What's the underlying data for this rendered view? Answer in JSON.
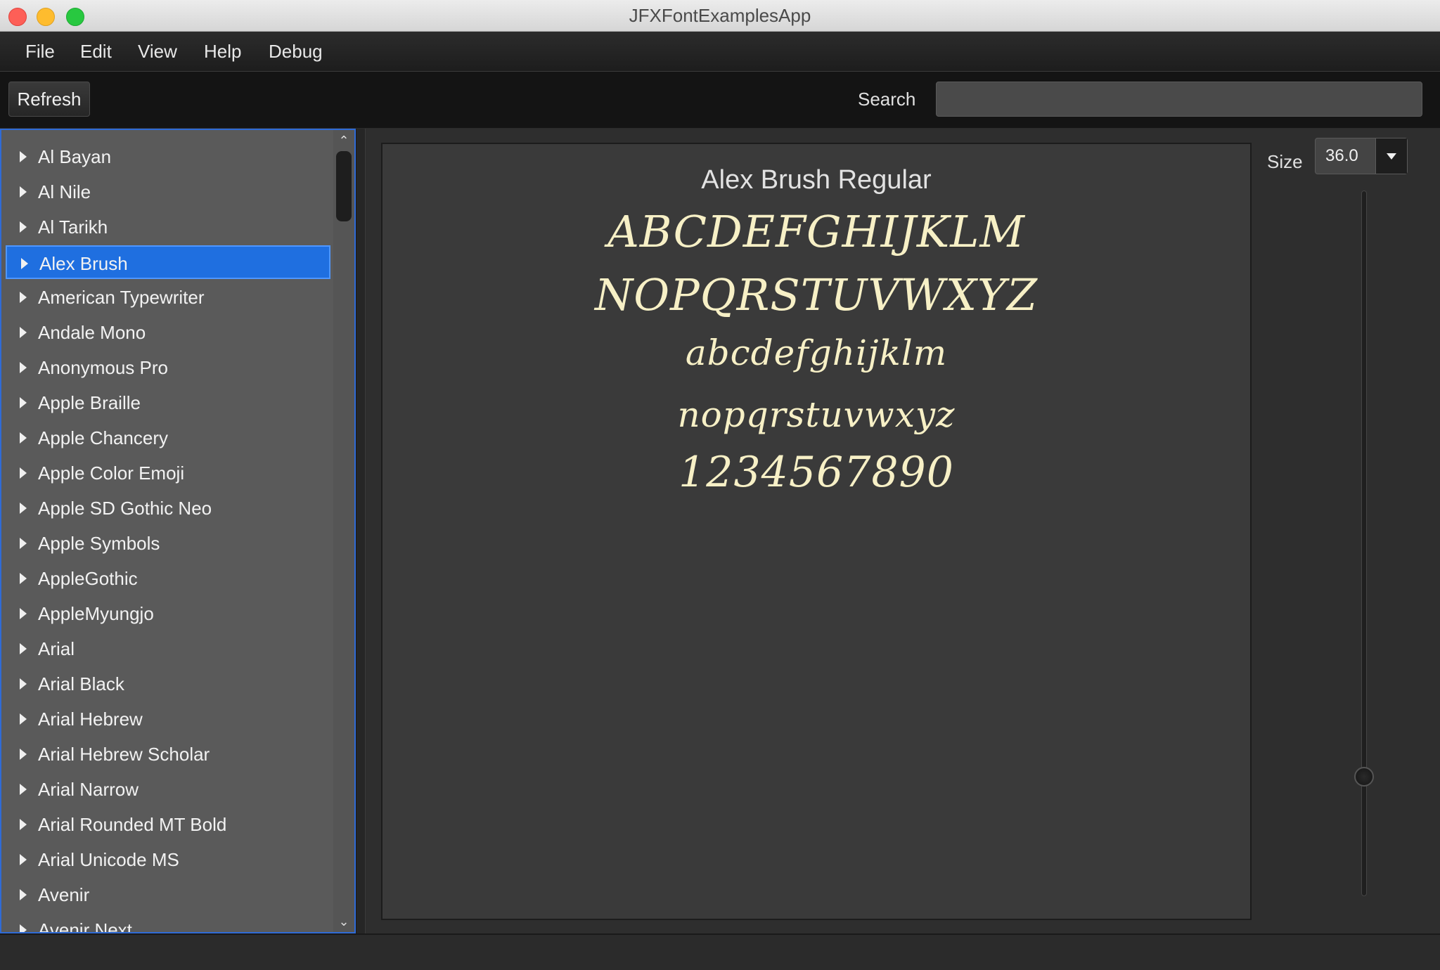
{
  "window": {
    "title": "JFXFontExamplesApp"
  },
  "menu": {
    "items": [
      "File",
      "Edit",
      "View",
      "Help",
      "Debug"
    ]
  },
  "toolbar": {
    "refresh_label": "Refresh",
    "search_label": "Search",
    "search_value": "",
    "search_placeholder": ""
  },
  "font_list": {
    "selected": "Alex Brush",
    "items": [
      "Al Bayan",
      "Al Nile",
      "Al Tarikh",
      "Alex Brush",
      "American Typewriter",
      "Andale Mono",
      "Anonymous Pro",
      "Apple Braille",
      "Apple Chancery",
      "Apple Color Emoji",
      "Apple SD Gothic Neo",
      "Apple Symbols",
      "AppleGothic",
      "AppleMyungjo",
      "Arial",
      "Arial Black",
      "Arial Hebrew",
      "Arial Hebrew Scholar",
      "Arial Narrow",
      "Arial Rounded MT Bold",
      "Arial Unicode MS",
      "Avenir",
      "Avenir Next"
    ]
  },
  "preview": {
    "font_name": "Alex Brush Regular",
    "lines": [
      "ABCDEFGHIJKLM",
      "NOPQRSTUVWXYZ",
      "abcdefghijklm",
      "nopqrstuvwxyz",
      "1234567890"
    ],
    "text_color": "#f7f0c6"
  },
  "size": {
    "label": "Size",
    "value": "36.0",
    "slider_fraction": 0.16
  },
  "icons": {
    "expand": "triangle-right-icon",
    "dropdown": "chevron-down-icon"
  }
}
